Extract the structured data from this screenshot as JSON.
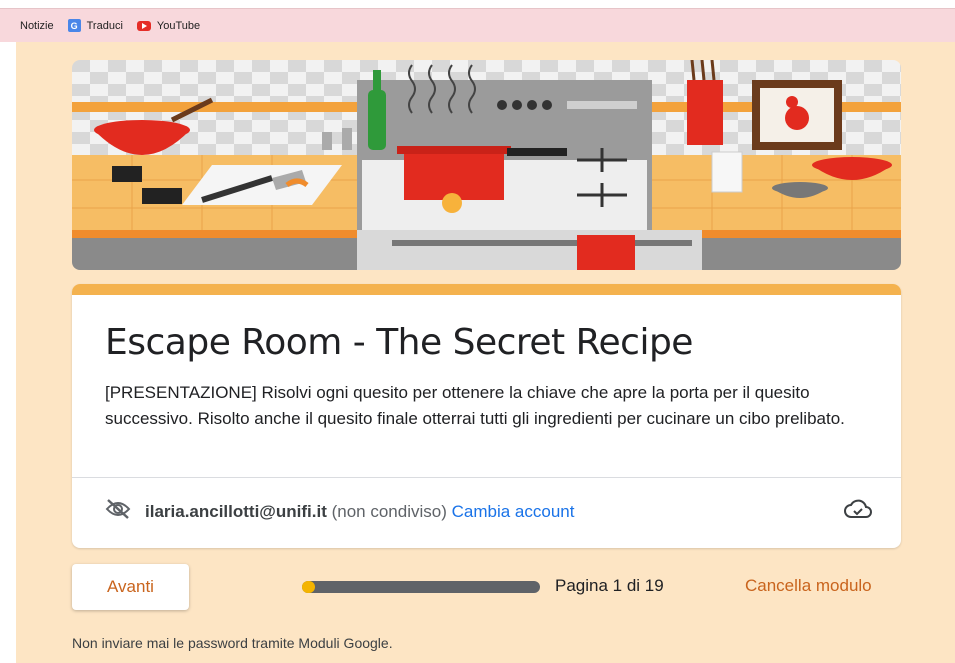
{
  "bookmarks": [
    {
      "label": "Notizie",
      "icon": "none"
    },
    {
      "label": "Traduci",
      "icon": "translate-icon"
    },
    {
      "label": "YouTube",
      "icon": "youtube-icon"
    }
  ],
  "form": {
    "title": "Escape Room - The Secret Recipe",
    "description": "[PRESENTAZIONE] Risolvi ogni quesito per ottenere la chiave che apre la porta per il quesito successivo. Risolto anche il quesito finale otterrai tutti gli ingredienti per cucinare un cibo prelibato.",
    "account_email": "ilaria.ancillotti@unifi.it",
    "account_note": "(non condiviso)",
    "switch_account": "Cambia account"
  },
  "nav": {
    "next_label": "Avanti",
    "page_indicator": "Pagina 1 di 19",
    "clear_label": "Cancella modulo",
    "progress_fraction": 0.053
  },
  "footer": {
    "warning": "Non inviare mai le password tramite Moduli Google."
  },
  "colors": {
    "page_bg": "#fde5c4",
    "accent": "#f4b24e",
    "action_text": "#c9641d",
    "link": "#1a73e8"
  }
}
